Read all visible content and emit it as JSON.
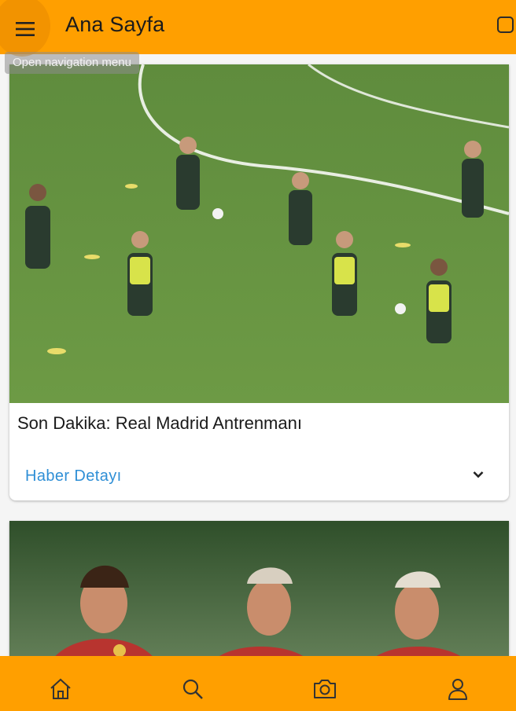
{
  "appbar": {
    "title": "Ana Sayfa",
    "menu_icon": "hamburger-menu-icon",
    "tooltip": "Open navigation menu",
    "accent_color": "#ff9f00"
  },
  "feed": {
    "cards": [
      {
        "title": "Son Dakika: Real Madrid Antrenmanı",
        "detail_label": "Haber Detayı",
        "detail_color": "#2f8fd6",
        "image": "football-training-photo"
      },
      {
        "image": "galatasaray-players-photo"
      }
    ]
  },
  "bottom_nav": {
    "items": [
      {
        "icon": "home-icon"
      },
      {
        "icon": "search-icon"
      },
      {
        "icon": "camera-icon"
      },
      {
        "icon": "profile-icon"
      }
    ]
  }
}
